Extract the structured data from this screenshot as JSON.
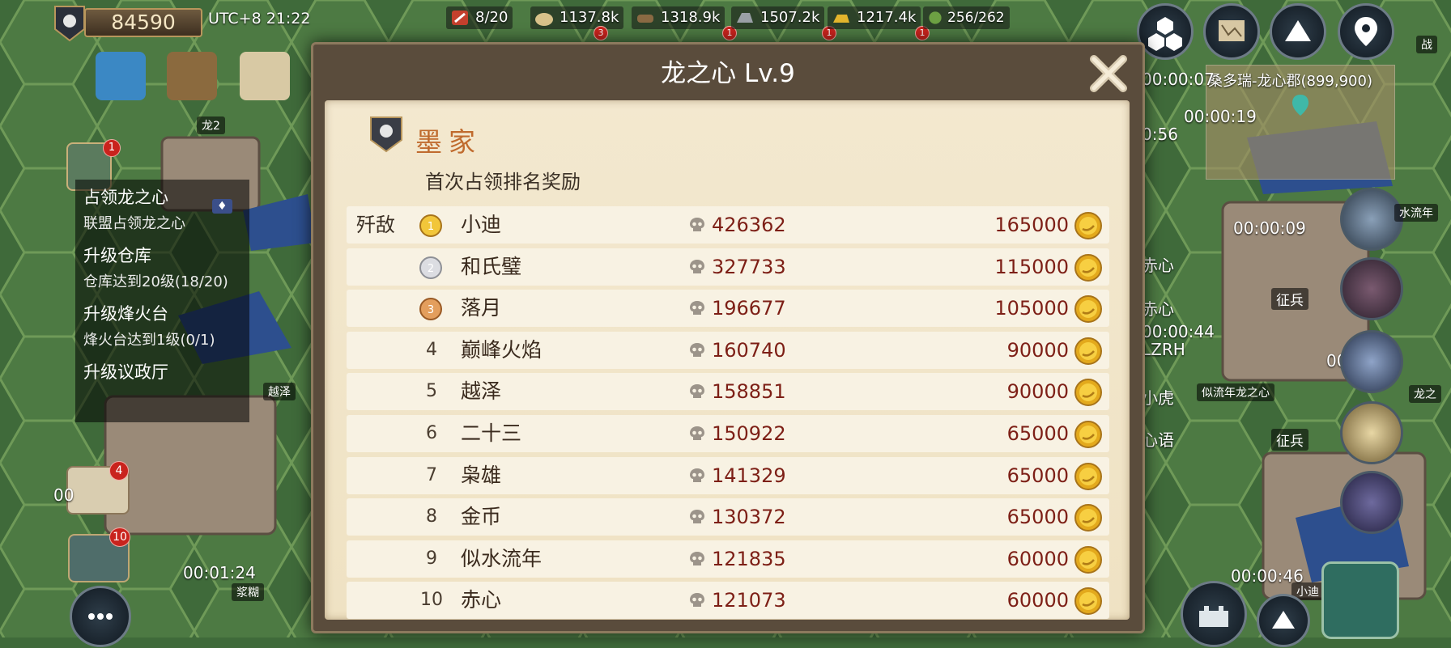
{
  "topbar": {
    "power": "84590",
    "clock": "UTC+8 21:22",
    "army": "8/20",
    "food": "1137.8k",
    "wood": "1318.9k",
    "stone": "1507.2k",
    "gold_res": "1217.4k",
    "troop_cap": "256/262",
    "badge_food": "3",
    "badge_left": "1",
    "badge_stone": "1",
    "badge_right": "1"
  },
  "left": {
    "quest_badge": "1",
    "quests": [
      {
        "title": "占领龙之心",
        "desc": "联盟占领龙之心"
      },
      {
        "title": "升级仓库",
        "desc": "仓库达到20级(18/20)"
      },
      {
        "title": "升级烽火台",
        "desc": "烽火台达到1级(0/1)"
      },
      {
        "title": "升级议政厅",
        "desc": ""
      }
    ],
    "mail_badge": "4",
    "battle_badge": "10",
    "timer": "00:01:24",
    "tag_long2": "龙2",
    "tag_yueze": "越泽",
    "tag_jianghu": "浆糊",
    "timer_partial": "00"
  },
  "dialog": {
    "title": "龙之心 Lv.9",
    "alliance": "墨家",
    "subtitle": "首次占领排名奖励",
    "first_label": "歼敌",
    "rows": [
      {
        "rank": "1",
        "name": "小迪",
        "kills": "426362",
        "reward": "165000"
      },
      {
        "rank": "2",
        "name": "和氏璧",
        "kills": "327733",
        "reward": "115000"
      },
      {
        "rank": "3",
        "name": "落月",
        "kills": "196677",
        "reward": "105000"
      },
      {
        "rank": "4",
        "name": "巅峰火焰",
        "kills": "160740",
        "reward": "90000"
      },
      {
        "rank": "5",
        "name": "越泽",
        "kills": "158851",
        "reward": "90000"
      },
      {
        "rank": "6",
        "name": "二十三",
        "kills": "150922",
        "reward": "65000"
      },
      {
        "rank": "7",
        "name": "枭雄",
        "kills": "141329",
        "reward": "65000"
      },
      {
        "rank": "8",
        "name": "金币",
        "kills": "130372",
        "reward": "65000"
      },
      {
        "rank": "9",
        "name": "似水流年",
        "kills": "121835",
        "reward": "60000"
      },
      {
        "rank": "10",
        "name": "赤心",
        "kills": "121073",
        "reward": "60000"
      }
    ]
  },
  "right": {
    "coords": "桑多瑞-龙心郡(899,900)",
    "timers": [
      "00:00:07",
      "00:00:19",
      "0:56",
      "00:00:09",
      "00:00:44",
      "00:00:21",
      "00:00:46"
    ],
    "labels": [
      "赤心",
      "赤心",
      "LZRH",
      "小虎",
      "心语"
    ],
    "hero1": "水流年",
    "conscript": "征兵",
    "conscript2": "征兵",
    "tag_dragon": "似流年龙之心",
    "tag_xiaodi": "小迪",
    "tag_longzhi": "龙之",
    "tag_zhan": "战"
  },
  "colors": {
    "alliance": "#c06b2e",
    "value": "#7d1f16",
    "panel": "#5a4c3c",
    "paper": "#f3e8cf"
  }
}
